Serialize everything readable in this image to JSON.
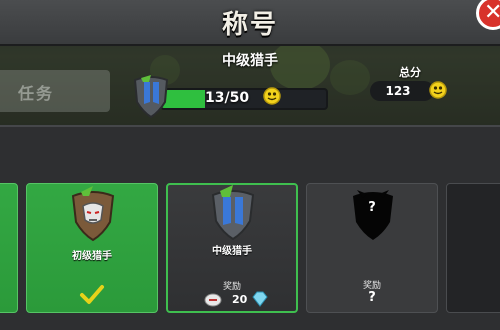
{
  "header": {
    "title": "称号"
  },
  "background_tab": {
    "label": "任务"
  },
  "current": {
    "title": "中级猎手",
    "progress_text": "13/50",
    "progress_fraction": 0.26
  },
  "total": {
    "label": "总分",
    "value": "123"
  },
  "cards": [
    {
      "label": "初级猎手",
      "state": "completed"
    },
    {
      "label": "中级猎手",
      "reward_label": "奖励",
      "reward_value": "20",
      "state": "current"
    },
    {
      "label": "",
      "reward_label": "奖励",
      "reward_value": "?",
      "state": "locked",
      "title_mark": "?"
    }
  ],
  "colors": {
    "accent_green": "#2fbf3f",
    "close_red": "#d8322b",
    "coin_yellow": "#f3d21c"
  },
  "icons": [
    "close-icon",
    "blue-boots-shield-icon",
    "coin-icon",
    "mask-shield-icon",
    "check-icon",
    "locked-shield-icon",
    "gem-icon",
    "token-icon"
  ]
}
